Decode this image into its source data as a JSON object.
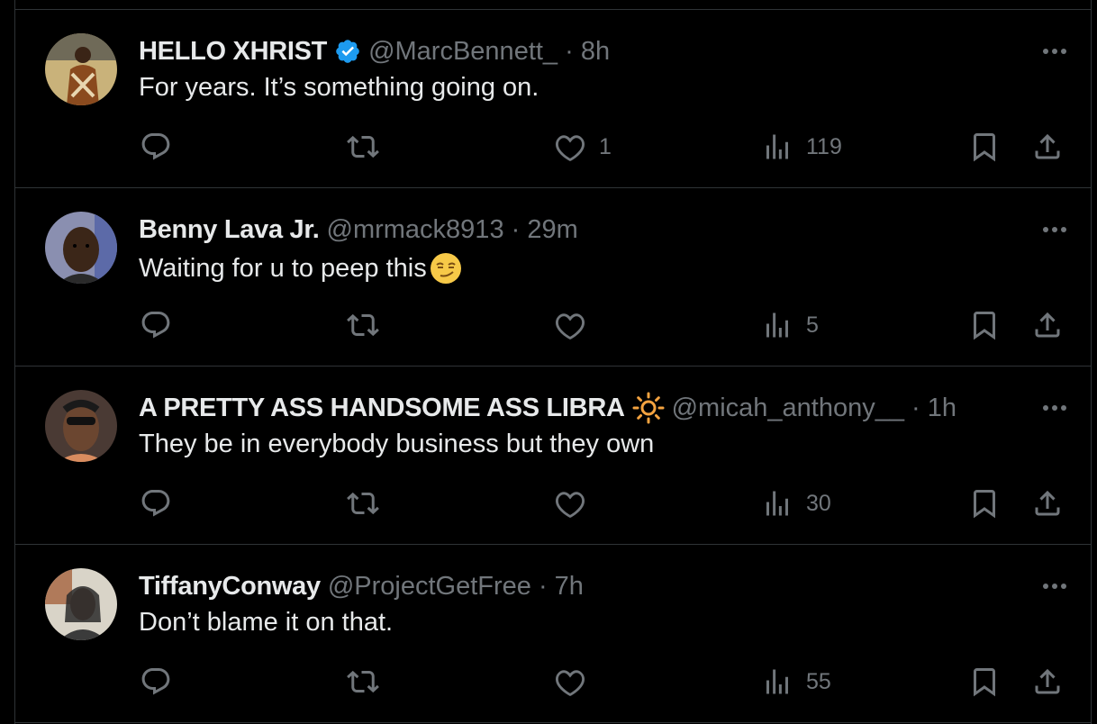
{
  "tweets": [
    {
      "name": "HELLO XHRIST",
      "verified": true,
      "handle_time": "@MarcBennett_ · 8h",
      "text": "For years. It’s something going on.",
      "likes": "1",
      "views": "119"
    },
    {
      "name": "Benny Lava Jr.",
      "verified": false,
      "handle_time": "@mrmack8913 · 29m",
      "text": "Waiting for u to peep this",
      "text_emoji": "smirking-face",
      "likes": "",
      "views": "5"
    },
    {
      "name": "A PRETTY ASS HANDSOME ASS LIBRA",
      "name_emoji": "sun",
      "verified": false,
      "handle_time": "@micah_anthony__ · 1h",
      "text": "They be in everybody business but they own",
      "likes": "",
      "views": "30"
    },
    {
      "name": "TiffanyConway",
      "verified": false,
      "handle_time": "@ProjectGetFree · 7h",
      "text": "Don’t blame it on that.",
      "likes": "",
      "views": "55"
    }
  ],
  "colors": {
    "background": "#000000",
    "text": "#e7e9ea",
    "secondary": "#71767b",
    "border": "#2f3336",
    "verified": "#1d9bf0"
  },
  "icons": [
    "reply-icon",
    "retweet-icon",
    "like-icon",
    "views-icon",
    "bookmark-icon",
    "share-icon",
    "more-icon",
    "verified-badge-icon"
  ]
}
